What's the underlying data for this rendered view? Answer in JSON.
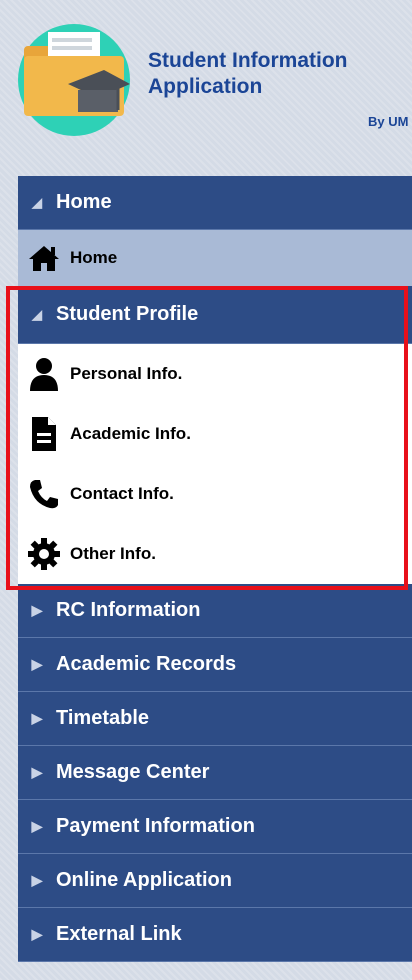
{
  "app": {
    "title_line1": "Student Information",
    "title_line2": "Application",
    "by": "By UM"
  },
  "menu": {
    "home_header": "Home",
    "home_item": "Home",
    "profile_header": "Student Profile",
    "profile_items": [
      {
        "label": "Personal Info.",
        "icon": "person-icon"
      },
      {
        "label": "Academic Info.",
        "icon": "document-icon"
      },
      {
        "label": "Contact Info.",
        "icon": "phone-icon"
      },
      {
        "label": "Other Info.",
        "icon": "gear-icon"
      }
    ],
    "sections": [
      "RC Information",
      "Academic Records",
      "Timetable",
      "Message Center",
      "Payment Information",
      "Online Application",
      "External Link"
    ]
  },
  "colors": {
    "header_bg": "#2d4c86",
    "subitem_bg": "#a9bad6",
    "highlight": "#e8101a",
    "title": "#1b4596"
  }
}
